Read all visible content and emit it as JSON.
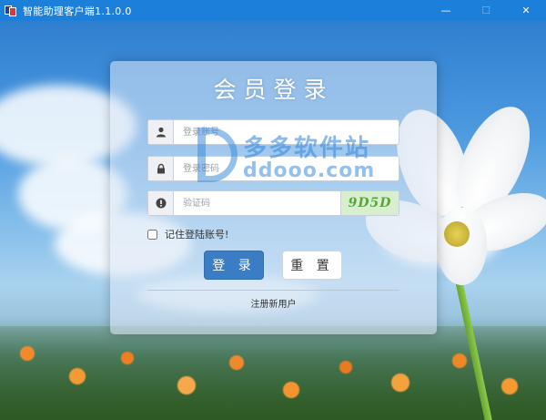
{
  "window": {
    "title": "智能助理客户端1.1.0.0",
    "minimize_glyph": "—",
    "maximize_glyph": "☐",
    "close_glyph": "✕"
  },
  "login": {
    "title": "会员登录",
    "username_placeholder": "登录账号",
    "password_placeholder": "登录密码",
    "captcha_placeholder": "验证码",
    "captcha_text": "9D5D",
    "remember_label": "记住登陆账号!",
    "login_button": "登 录",
    "reset_button": "重 置",
    "register_link": "注册新用户"
  },
  "watermark": {
    "cn": "多多软件站",
    "en": "ddooo.com"
  },
  "icons": {
    "user": "user-icon",
    "lock": "lock-icon",
    "exclamation": "exclamation-circle-icon"
  },
  "colors": {
    "titlebar": "#1c7fd9",
    "login_button": "#3a7dc4",
    "captcha_text": "#5ba53a"
  }
}
